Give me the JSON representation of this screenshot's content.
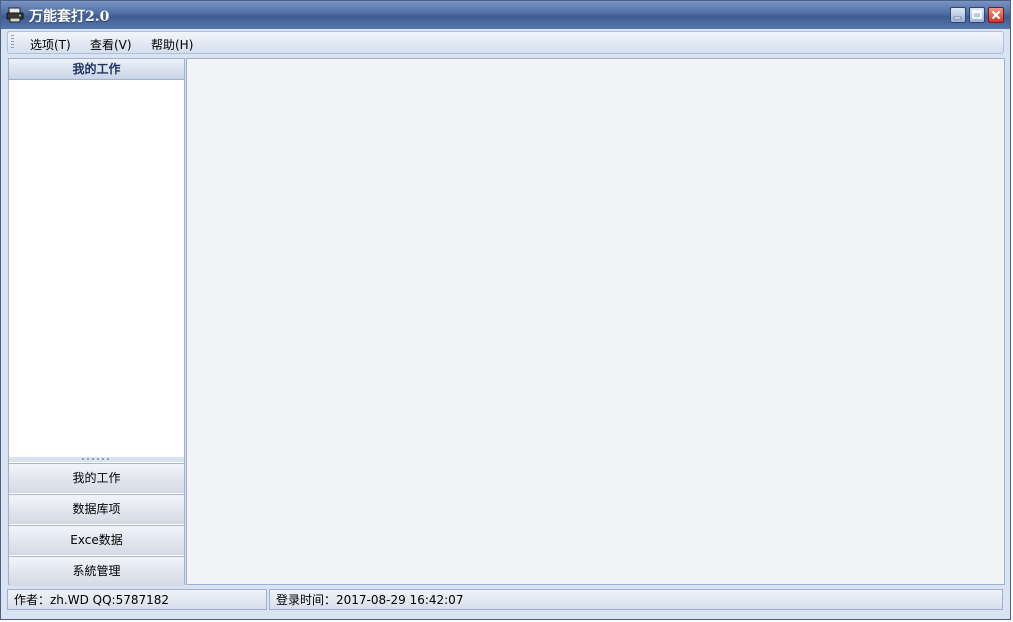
{
  "window": {
    "title": "万能套打2.0",
    "icon": "printer-app-icon",
    "controls": {
      "minimize": "minimize-icon",
      "maximize": "maximize-icon",
      "close": "close-icon"
    }
  },
  "menubar": {
    "items": [
      {
        "label": "选项(T)"
      },
      {
        "label": "查看(V)"
      },
      {
        "label": "帮助(H)"
      }
    ]
  },
  "sidebar": {
    "header": "我的工作",
    "nav": [
      {
        "label": "我的工作"
      },
      {
        "label": "数据库项"
      },
      {
        "label": "Exce数据"
      },
      {
        "label": "系統管理"
      }
    ]
  },
  "statusbar": {
    "author": "作者：zh.WD   QQ:5787182",
    "login_time": "登录时间：2017-08-29 16:42:07"
  },
  "colors": {
    "titlebar": "#4f6da3",
    "frame": "#d9e3f1",
    "content_bg": "#f3f4f7"
  }
}
